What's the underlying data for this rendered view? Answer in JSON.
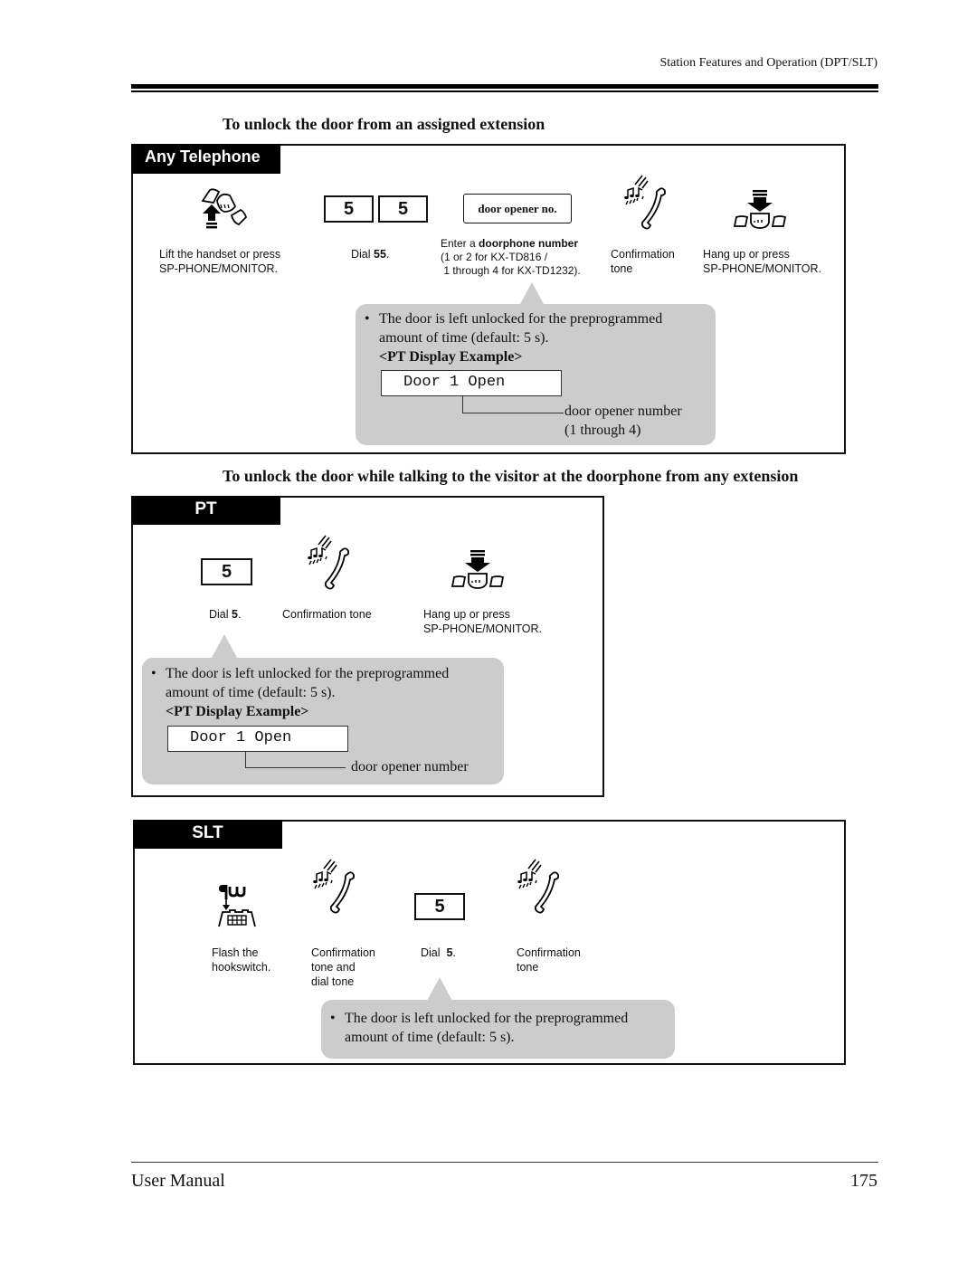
{
  "header": {
    "running_title": "Station Features and Operation (DPT/SLT)"
  },
  "section1": {
    "title": "To unlock the door from an assigned extension",
    "panel_label": "Any Telephone",
    "steps": [
      {
        "icon": "lift-handset-icon",
        "caption_lines": [
          "Lift the handset or press",
          "SP-PHONE/MONITOR."
        ]
      },
      {
        "keys": [
          "5",
          "5"
        ],
        "caption_prefix": "Dial ",
        "caption_bold": "55",
        "caption_suffix": "."
      },
      {
        "entry_label": "door opener no.",
        "caption_line1_prefix": "Enter a ",
        "caption_line1_bold": "doorphone number",
        "caption_line2": "(1 or 2 for KX-TD816 /",
        "caption_line3": " 1 through 4 for KX-TD1232)."
      },
      {
        "icon": "confirmation-tone-icon",
        "caption_lines": [
          "Confirmation",
          "tone"
        ]
      },
      {
        "icon": "hang-up-icon",
        "caption_lines": [
          "Hang up or press",
          "SP-PHONE/MONITOR."
        ]
      }
    ],
    "note": {
      "bullet": "•",
      "line1": "The door is left unlocked for the preprogrammed",
      "line2": "amount of time (default: 5 s).",
      "display_heading": "<PT Display Example>",
      "display_text": "Door 1 Open",
      "callout_line1": "door opener number",
      "callout_line2": "(1 through 4)"
    }
  },
  "section2": {
    "title": "To unlock the door while talking to the visitor at the doorphone from any extension",
    "panel_label": "PT",
    "steps": [
      {
        "keys": [
          "5"
        ],
        "caption_prefix": "Dial ",
        "caption_bold": "5",
        "caption_suffix": "."
      },
      {
        "icon": "confirmation-tone-icon",
        "caption_lines": [
          "Confirmation tone"
        ]
      },
      {
        "icon": "hang-up-icon",
        "caption_lines": [
          "Hang up or press",
          "SP-PHONE/MONITOR."
        ]
      }
    ],
    "note": {
      "bullet": "•",
      "line1": "The door is left unlocked for the preprogrammed",
      "line2": "amount of time (default: 5 s).",
      "display_heading": "<PT Display Example>",
      "display_text": "Door 1 Open",
      "callout_line1": "door opener number"
    }
  },
  "section3": {
    "panel_label": "SLT",
    "steps": [
      {
        "icon": "flash-hookswitch-icon",
        "caption_lines": [
          "Flash the",
          "hookswitch."
        ]
      },
      {
        "icon": "confirmation-tone-icon",
        "caption_lines": [
          "Confirmation",
          "tone and",
          "dial tone"
        ]
      },
      {
        "keys": [
          "5"
        ],
        "caption_prefix": "Dial  ",
        "caption_bold": "5",
        "caption_suffix": "."
      },
      {
        "icon": "confirmation-tone-icon",
        "caption_lines": [
          "Confirmation",
          "tone"
        ]
      }
    ],
    "note": {
      "bullet": "•",
      "line1": "The door is left unlocked for the preprogrammed",
      "line2": "amount of time (default: 5 s)."
    }
  },
  "footer": {
    "left": "User Manual",
    "page_number": "175"
  }
}
